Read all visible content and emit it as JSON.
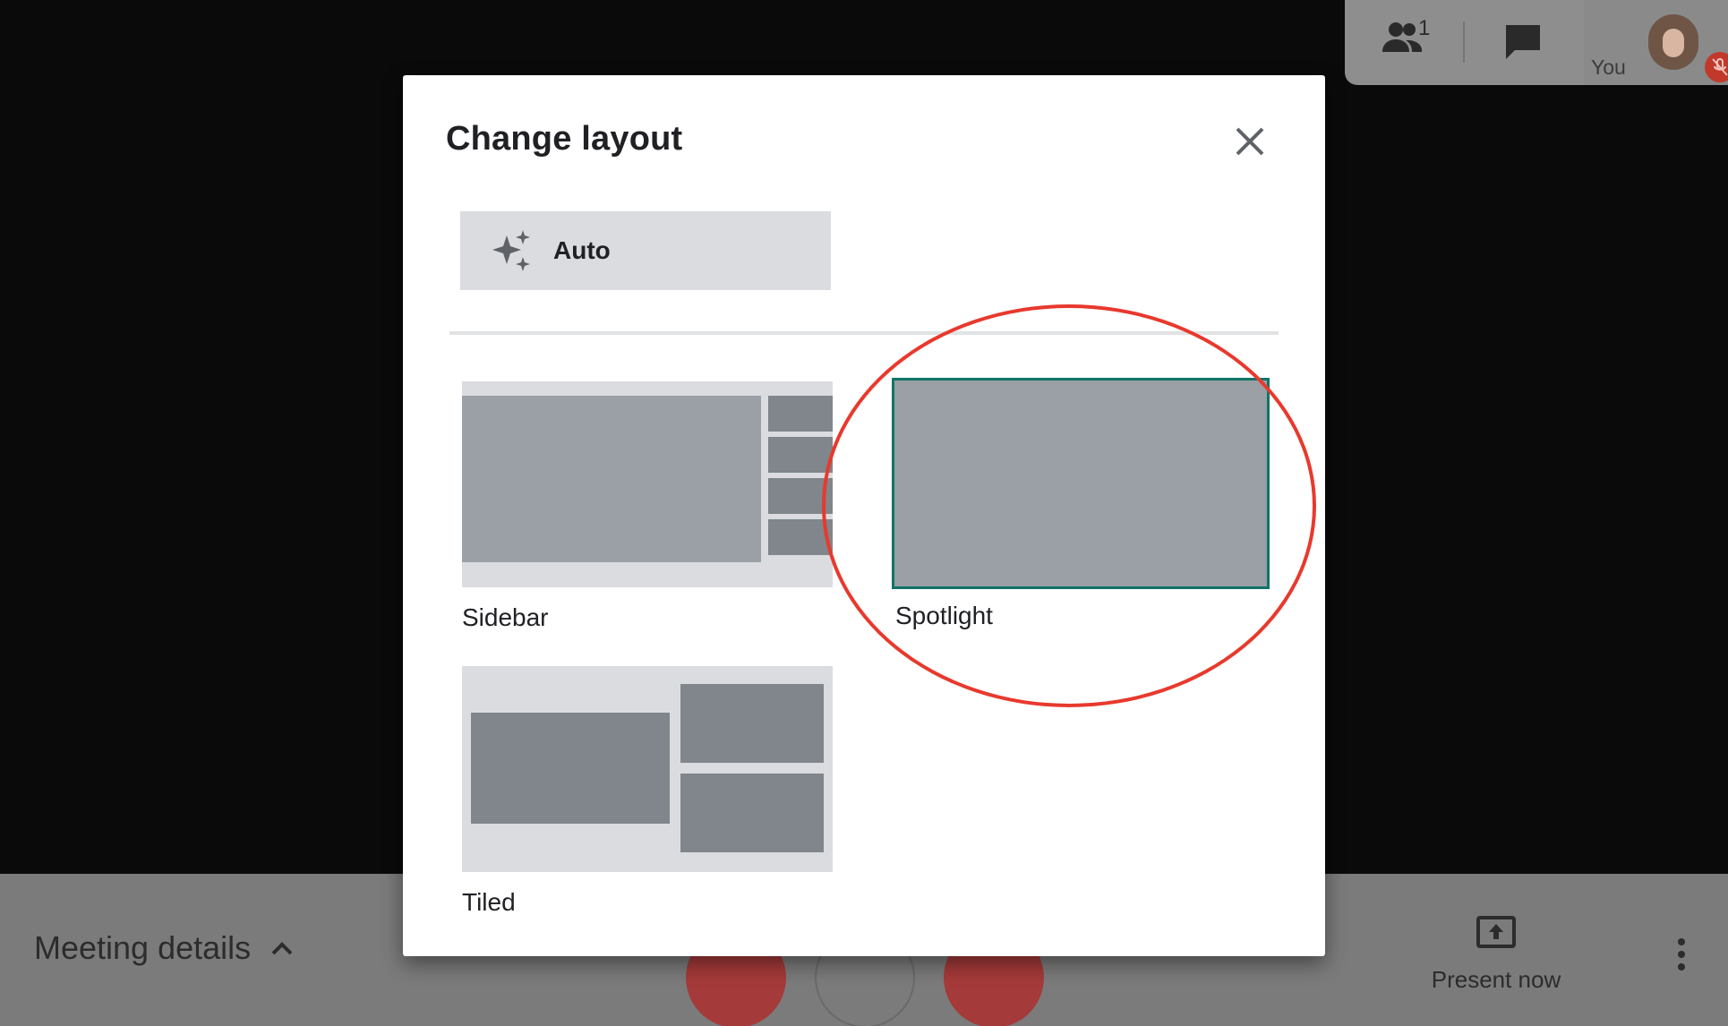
{
  "participants_panel": {
    "people_count": "1",
    "self_label": "You",
    "icons": {
      "people": "people-icon",
      "chat": "chat-icon",
      "mic": "mic-off-icon"
    }
  },
  "bottom_bar": {
    "meeting_details_label": "Meeting details",
    "present_now_label": "Present now",
    "icons": {
      "expand": "chevron-up-icon",
      "present": "present-screen-icon",
      "more": "more-vert-icon"
    }
  },
  "modal": {
    "title": "Change layout",
    "auto_label": "Auto",
    "options": [
      {
        "label": "Sidebar",
        "selected": false
      },
      {
        "label": "Spotlight",
        "selected": true
      },
      {
        "label": "Tiled",
        "selected": false
      }
    ],
    "icons": {
      "close": "close-icon",
      "auto": "sparkle-icon"
    }
  },
  "colors": {
    "selected_border": "#127368",
    "annotation": "#e8392d",
    "thumb_background": "#dadce0",
    "thumb_block": "#80868b",
    "call_button_red": "#a53a3a"
  }
}
